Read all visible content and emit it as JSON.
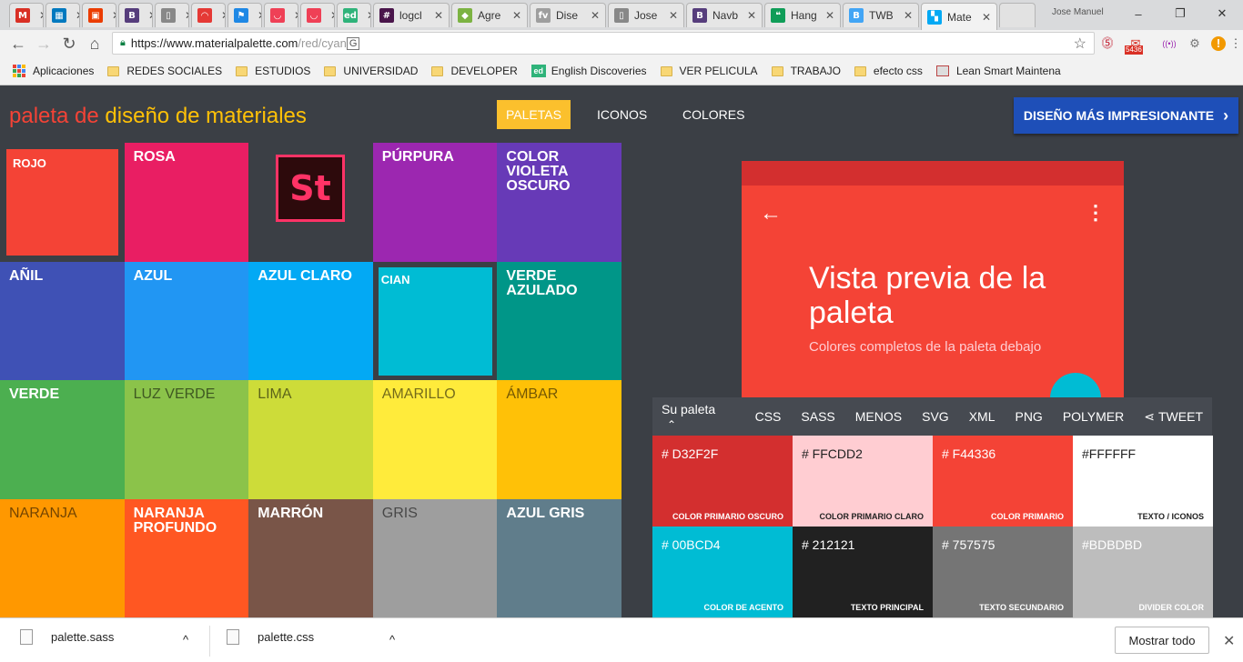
{
  "browser": {
    "tabs": [
      {
        "label": "",
        "icon": "gmail-icon",
        "icon_char": "M",
        "color": "#d93025"
      },
      {
        "label": "",
        "icon": "trello-icon",
        "icon_char": "▦",
        "color": "#0079bf"
      },
      {
        "label": "",
        "icon": "office-icon",
        "icon_char": "▣",
        "color": "#eb3c00"
      },
      {
        "label": "",
        "icon": "bootstrap-icon",
        "icon_char": "B",
        "color": "#563d7c"
      },
      {
        "label": "",
        "icon": "document-icon",
        "icon_char": "▯",
        "color": "#888888"
      },
      {
        "label": "",
        "icon": "arc-icon",
        "icon_char": "◠",
        "color": "#e53935"
      },
      {
        "label": "",
        "icon": "flag-icon",
        "icon_char": "⚑",
        "color": "#1e88e5"
      },
      {
        "label": "",
        "icon": "pocket-icon",
        "icon_char": "◡",
        "color": "#ef4056"
      },
      {
        "label": "",
        "icon": "pocket-icon",
        "icon_char": "◡",
        "color": "#ef4056"
      },
      {
        "label": "",
        "icon": "ed-icon",
        "icon_char": "ed",
        "color": "#2fb37a"
      },
      {
        "label": "logcl",
        "icon": "slack-icon",
        "icon_char": "#",
        "color": "#4a154b"
      },
      {
        "label": "Agre",
        "icon": "diamond-icon",
        "icon_char": "◆",
        "color": "#7cb342"
      },
      {
        "label": "Dise",
        "icon": "fv-icon",
        "icon_char": "fv",
        "color": "#9e9e9e"
      },
      {
        "label": "Jose",
        "icon": "document-icon",
        "icon_char": "▯",
        "color": "#888888"
      },
      {
        "label": "Navb",
        "icon": "bootstrap-icon",
        "icon_char": "B",
        "color": "#563d7c"
      },
      {
        "label": "Hang",
        "icon": "hangouts-icon",
        "icon_char": "❝",
        "color": "#0f9d58"
      },
      {
        "label": "TWB",
        "icon": "twb-icon",
        "icon_char": "B",
        "color": "#42a5f5"
      },
      {
        "label": "Mate",
        "icon": "materialpalette-icon",
        "icon_char": "▚",
        "color": "#03a9f4"
      }
    ],
    "user": "Jose Manuel",
    "window_controls": [
      "–",
      "❐",
      "✕"
    ],
    "url_host": "https://www.materialpalette.com",
    "url_path": "/red/cyan",
    "extensions": [
      {
        "name": "pinterest-icon",
        "char": "⓹",
        "color": "#bd081c"
      },
      {
        "name": "gmail-notifier-icon",
        "char": "✉",
        "color": "#d93025",
        "badge": "5436"
      },
      {
        "name": "broadcast-icon",
        "char": "((•))",
        "color": "#9c27b0"
      },
      {
        "name": "settings-extension-icon",
        "char": "⚙",
        "color": "#777777"
      },
      {
        "name": "alert-icon",
        "char": "!",
        "color": "#f29900"
      },
      {
        "name": "menu-icon",
        "char": "⋮",
        "color": "#555555"
      }
    ],
    "bookmarks": [
      "Aplicaciones",
      "REDES SOCIALES",
      "ESTUDIOS",
      "UNIVERSIDAD",
      "DEVELOPER",
      "English Discoveries",
      "VER PELICULA",
      "TRABAJO",
      "efecto css",
      "Lean Smart Maintena"
    ]
  },
  "header": {
    "logo_part1": "paleta de ",
    "logo_part2": "diseño de materiales",
    "nav": [
      "PALETAS",
      "ICONOS",
      "COLORES"
    ],
    "cta": "DISEÑO MÁS IMPRESIONANTE",
    "cta_icon": "›"
  },
  "colors": [
    {
      "name": "ROJO",
      "hex": "#f44336"
    },
    {
      "name": "ROSA",
      "hex": "#e91e63"
    },
    {
      "name": "",
      "hex": "#3b3f45"
    },
    {
      "name": "PÚRPURA",
      "hex": "#9c27b0"
    },
    {
      "name": "COLOR VIOLETA OSCURO",
      "hex": "#673ab7"
    },
    {
      "name": "AÑIL",
      "hex": "#3f51b5"
    },
    {
      "name": "AZUL",
      "hex": "#2196f3"
    },
    {
      "name": "AZUL CLARO",
      "hex": "#03a9f4"
    },
    {
      "name": "CIAN",
      "hex": "#00bcd4"
    },
    {
      "name": "VERDE AZULADO",
      "hex": "#009688"
    },
    {
      "name": "VERDE",
      "hex": "#4caf50"
    },
    {
      "name": "LUZ VERDE",
      "hex": "#8bc34a"
    },
    {
      "name": "LIMA",
      "hex": "#cddc39"
    },
    {
      "name": "AMARILLO",
      "hex": "#ffeb3b"
    },
    {
      "name": "ÁMBAR",
      "hex": "#ffc107"
    },
    {
      "name": "NARANJA",
      "hex": "#ff9800"
    },
    {
      "name": "NARANJA PROFUNDO",
      "hex": "#ff5722"
    },
    {
      "name": "MARRÓN",
      "hex": "#795548"
    },
    {
      "name": "GRIS",
      "hex": "#9e9e9e"
    },
    {
      "name": "AZUL GRIS",
      "hex": "#607d8b"
    }
  ],
  "promo_logo": "St",
  "preview": {
    "title": "Vista previa de la paleta",
    "subtitle": "Colores completos de la paleta debajo",
    "back_icon": "←",
    "more_icon": "⋮"
  },
  "palette": {
    "label": "Su paleta",
    "label_icon": "⌃",
    "options": [
      "CSS",
      "SASS",
      "MENOS",
      "SVG",
      "XML",
      "PNG",
      "POLYMER"
    ],
    "tweet": "TWEET",
    "tweet_icon": "⋖",
    "swatches": [
      {
        "hex": "# D32F2F",
        "label": "COLOR PRIMARIO OSCURO",
        "bg": "#d32f2f",
        "fg": "#ffffff"
      },
      {
        "hex": "# FFCDD2",
        "label": "COLOR PRIMARIO CLARO",
        "bg": "#ffcdd2",
        "fg": "#212121"
      },
      {
        "hex": "# F44336",
        "label": "COLOR PRIMARIO",
        "bg": "#f44336",
        "fg": "#ffffff"
      },
      {
        "hex": "#FFFFFF",
        "label": "TEXTO / ICONOS",
        "bg": "#ffffff",
        "fg": "#212121"
      },
      {
        "hex": "# 00BCD4",
        "label": "COLOR DE ACENTO",
        "bg": "#00bcd4",
        "fg": "#ffffff"
      },
      {
        "hex": "# 212121",
        "label": "TEXTO PRINCIPAL",
        "bg": "#212121",
        "fg": "#ffffff"
      },
      {
        "hex": "# 757575",
        "label": "TEXTO SECUNDARIO",
        "bg": "#757575",
        "fg": "#ffffff"
      },
      {
        "hex": "#BDBDBD",
        "label": "DIVIDER COLOR",
        "bg": "#bdbdbd",
        "fg": "#ffffff"
      }
    ]
  },
  "downloads": {
    "items": [
      "palette.sass",
      "palette.css"
    ],
    "chevron": "^",
    "show_all": "Mostrar todo",
    "close": "✕"
  }
}
